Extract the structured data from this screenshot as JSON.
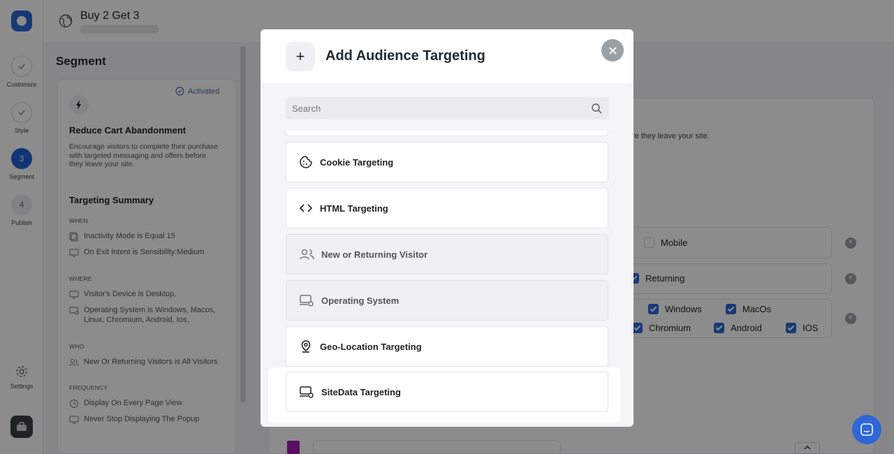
{
  "header": {
    "title": "Buy 2 Get 3"
  },
  "rail": {
    "steps": [
      {
        "label": "Customize",
        "num": ""
      },
      {
        "label": "Style",
        "num": ""
      },
      {
        "label": "Segment",
        "num": "3"
      },
      {
        "label": "Publish",
        "num": "4"
      }
    ],
    "settings_label": "Settings"
  },
  "sidebar": {
    "title": "Segment",
    "card": {
      "badge": "Activated",
      "title": "Reduce Cart Abandonment",
      "description": "Encourage visitors to complete their purchase with targeted messaging and offers before they leave your site.",
      "summary_title": "Targeting Summary",
      "sections": [
        {
          "heading": "WHEN",
          "rows": [
            "Inactivity Mode is Equal 15",
            "On Exit Intent is Sensibility:Medium"
          ]
        },
        {
          "heading": "WHERE",
          "rows": [
            "Visitor's Device is Desktop,",
            "Operating System is Windows, Macos, Linux, Chromium, Android, Ios,"
          ]
        },
        {
          "heading": "WHO",
          "rows": [
            "New Or Returning Visitors is All Visitors"
          ]
        },
        {
          "heading": "FREQUENCY",
          "rows": [
            "Display On Every Page View.",
            "Never Stop Displaying The Popup"
          ]
        }
      ]
    }
  },
  "main": {
    "desc_fragment": "re they leave your site.",
    "options": {
      "mobile": "Mobile",
      "returning": "Returning",
      "windows": "Windows",
      "macos": "MacOs",
      "chromium": "Chromium",
      "android": "Android",
      "ios": "IOS"
    }
  },
  "modal": {
    "title": "Add Audience Targeting",
    "search_placeholder": "Search",
    "items": [
      {
        "label": "Cookie Targeting",
        "icon": "cookie-icon",
        "enabled": true
      },
      {
        "label": "HTML Targeting",
        "icon": "code-icon",
        "enabled": true
      },
      {
        "label": "New or Returning Visitor",
        "icon": "users-icon",
        "enabled": false
      },
      {
        "label": "Operating System",
        "icon": "os-icon",
        "enabled": false
      },
      {
        "label": "Geo-Location Targeting",
        "icon": "location-pin-icon",
        "enabled": true
      },
      {
        "label": "SiteData Targeting",
        "icon": "laptop-gear-icon",
        "enabled": true
      }
    ]
  },
  "colors": {
    "accent": "#2f66d8",
    "overlay": "rgba(0,0,0,0.45)",
    "tag": "#a21caf"
  }
}
